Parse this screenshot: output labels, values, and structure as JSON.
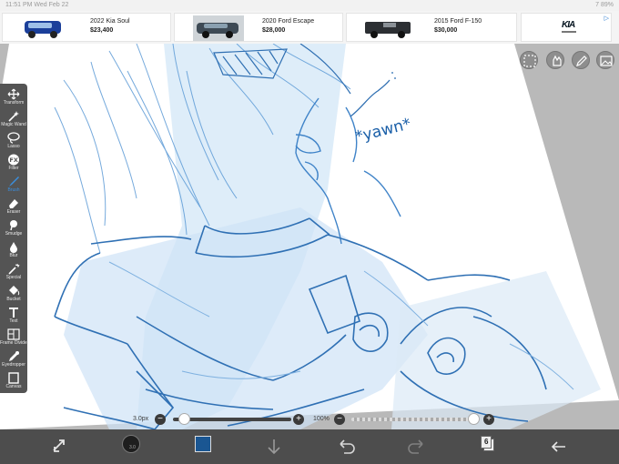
{
  "status_bar": {
    "time": "11:51 PM  Wed Feb 22",
    "right": "7 89%"
  },
  "ad": {
    "cards": [
      {
        "name": "2022 Kia Soul",
        "price": "$23,400",
        "car_color": "#1b3f9a"
      },
      {
        "name": "2020 Ford Escape",
        "price": "$28,000",
        "car_color": "#3e4a55"
      },
      {
        "name": "2015 Ford F-150",
        "price": "$30,000",
        "car_color": "#2c2f33"
      }
    ],
    "logo": {
      "text": "KIA",
      "adchoice": "▷"
    }
  },
  "toolbar": {
    "tools": [
      {
        "label": "Transform",
        "icon": "move-icon"
      },
      {
        "label": "Magic Wand",
        "icon": "magic-wand-icon"
      },
      {
        "label": "Lasso",
        "icon": "lasso-icon"
      },
      {
        "label": "Filter",
        "icon": "filter-icon"
      },
      {
        "label": "Brush",
        "icon": "brush-icon"
      },
      {
        "label": "Eraser",
        "icon": "eraser-icon"
      },
      {
        "label": "Smudge",
        "icon": "smudge-icon"
      },
      {
        "label": "Blur",
        "icon": "blur-icon"
      },
      {
        "label": "Special",
        "icon": "special-icon"
      },
      {
        "label": "Bucket",
        "icon": "bucket-icon"
      },
      {
        "label": "Text",
        "icon": "text-icon"
      },
      {
        "label": "Frame Divider",
        "icon": "frame-divider-icon"
      },
      {
        "label": "Eyedropper",
        "icon": "eyedropper-icon"
      },
      {
        "label": "Canvas",
        "icon": "canvas-icon"
      }
    ]
  },
  "canvas_text": "*yawn*",
  "sliders": {
    "brush_size": "3.0px",
    "opacity": "100%"
  },
  "bottom_bar": {
    "brush_size_preview": "3.0",
    "color": "#1a5692",
    "layer_count": "6"
  }
}
